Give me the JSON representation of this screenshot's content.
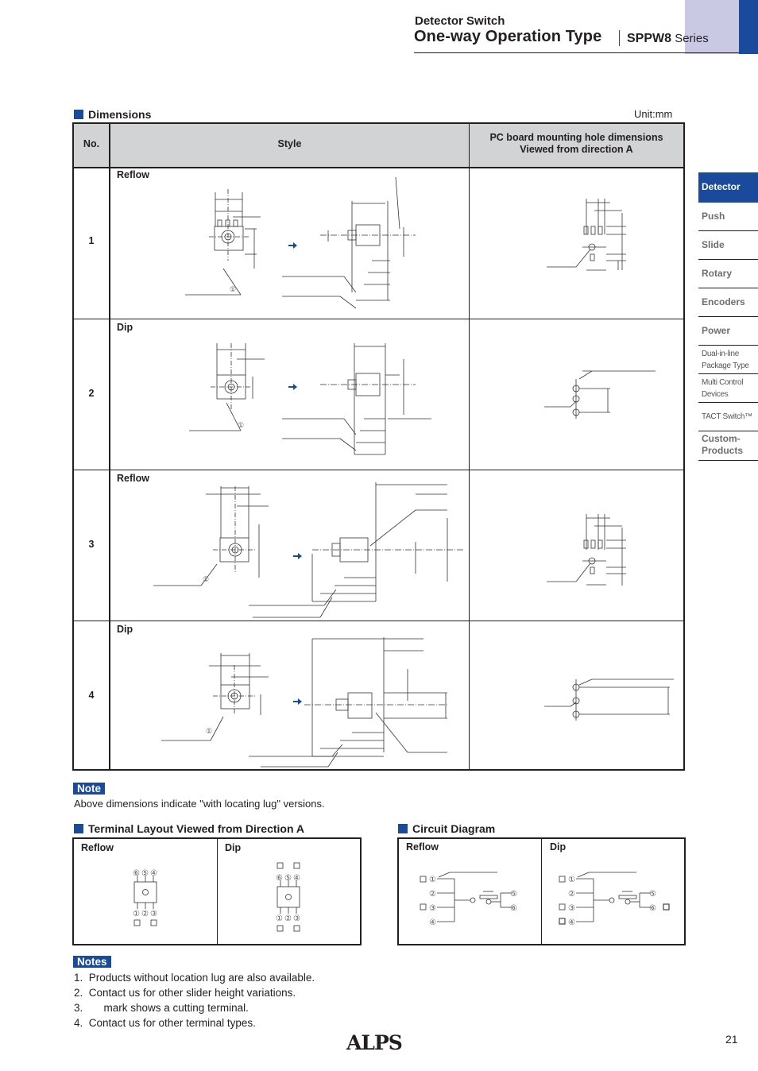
{
  "header": {
    "category": "Detector Switch",
    "title": "One-way Operation Type",
    "series_code": "SPPW8",
    "series_label": "Series"
  },
  "side_nav": {
    "items": [
      {
        "label": "Detector",
        "active": true
      },
      {
        "label": "Push"
      },
      {
        "label": "Slide"
      },
      {
        "label": "Rotary"
      },
      {
        "label": "Encoders"
      },
      {
        "label": "Power"
      },
      {
        "label_line1": "Dual-in-line",
        "label_line2": "Package Type"
      },
      {
        "label_line1": "Multi Control",
        "label_line2": "Devices"
      },
      {
        "label": "TACT Switch™"
      },
      {
        "label_line1": "Custom-",
        "label_line2": "Products"
      }
    ]
  },
  "dimensions": {
    "title": "Dimensions",
    "unit": "Unit:mm",
    "columns": {
      "no": "No.",
      "style": "Style",
      "pc_line1": "PC board mounting hole dimensions",
      "pc_line2": "Viewed from direction A"
    },
    "rows": [
      {
        "no": "1",
        "style": "Reflow",
        "callout": "①"
      },
      {
        "no": "2",
        "style": "Dip",
        "callout": "①"
      },
      {
        "no": "3",
        "style": "Reflow",
        "callout": "①"
      },
      {
        "no": "4",
        "style": "Dip",
        "callout": "①"
      }
    ],
    "direction_arrow_color": "#1a4a9c"
  },
  "note": {
    "label": "Note",
    "text": "Above dimensions indicate \"with locating lug\" versions."
  },
  "terminal_layout": {
    "title": "Terminal Layout  Viewed from Direction A",
    "reflow_label": "Reflow",
    "dip_label": "Dip",
    "top_pins": [
      "⑥",
      "⑤",
      "④"
    ],
    "bottom_pins": [
      "①",
      "②",
      "③"
    ]
  },
  "circuit_diagram": {
    "title": "Circuit Diagram",
    "reflow_label": "Reflow",
    "dip_label": "Dip",
    "left_pins": [
      "①",
      "②",
      "③",
      "④"
    ],
    "right_pins": [
      "⑤",
      "⑥"
    ]
  },
  "notes": {
    "label": "Notes",
    "items": [
      "1.  Products without location lug are also available.",
      "2.  Contact us for other slider height variations.",
      "3.       mark shows a cutting terminal.",
      "4.  Contact us for other terminal types."
    ]
  },
  "footer": {
    "brand": "ALPS",
    "page_number": "21"
  },
  "colors": {
    "brand_blue": "#1a4a9c",
    "accent_lavender": "#c9c9e4",
    "table_header_gray": "#d1d3d4"
  }
}
